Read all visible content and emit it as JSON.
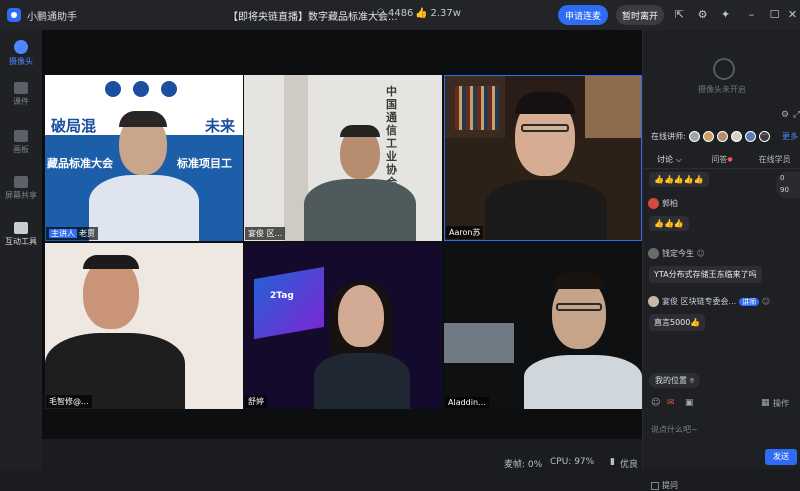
{
  "app": {
    "name": "小鹏通助手"
  },
  "meeting": {
    "title": "【即将央链直播】数字藏品标准大会...",
    "viewers": "4486",
    "likes": "2.37w"
  },
  "header": {
    "apply_mic": "申请连麦",
    "leave": "暂时离开"
  },
  "sidebar": {
    "items": [
      {
        "label": "摄像头"
      },
      {
        "label": "课件"
      },
      {
        "label": "画板"
      },
      {
        "label": "屏幕共享"
      },
      {
        "label": "互动工具"
      }
    ]
  },
  "videos": [
    {
      "name": "主讲人",
      "sub": "老贾",
      "banner_left": "破局混",
      "banner_right": "未来",
      "banner_line": "藏品标准大会",
      "banner_line2": "标准项目工"
    },
    {
      "name": "宴俊 区...",
      "wall_text": "中国通信工业协会区块链专业委"
    },
    {
      "name": "Aaron苏"
    },
    {
      "name": "毛智修@..."
    },
    {
      "name": "舒婷",
      "chip_text": "2Tag"
    },
    {
      "name": "Aladdin..."
    }
  ],
  "status": {
    "mic": "麦帧: 0%",
    "cpu": "CPU: 97%",
    "network": "优良"
  },
  "chat": {
    "camera_off": "摄像头未开启",
    "lecturers_label": "在线讲师:",
    "more": "更多",
    "tabs": [
      "讨论",
      "问答",
      "在线学员"
    ],
    "messages": [
      {
        "user": "",
        "text": "👍👍👍👍👍"
      },
      {
        "user": "郭柏",
        "text": "👍👍👍"
      },
      {
        "user": "钱定今生",
        "text": "YTA分布式存储王东临来了吗"
      },
      {
        "user": "宴俊 区块链专委会...",
        "badge": "讲师",
        "text": "直言5000👍"
      }
    ],
    "location": "我的位置",
    "input_placeholder": "说点什么吧~",
    "ask": "提问",
    "send": "发送",
    "tools": "操作",
    "float_values": [
      "0",
      "90"
    ]
  }
}
